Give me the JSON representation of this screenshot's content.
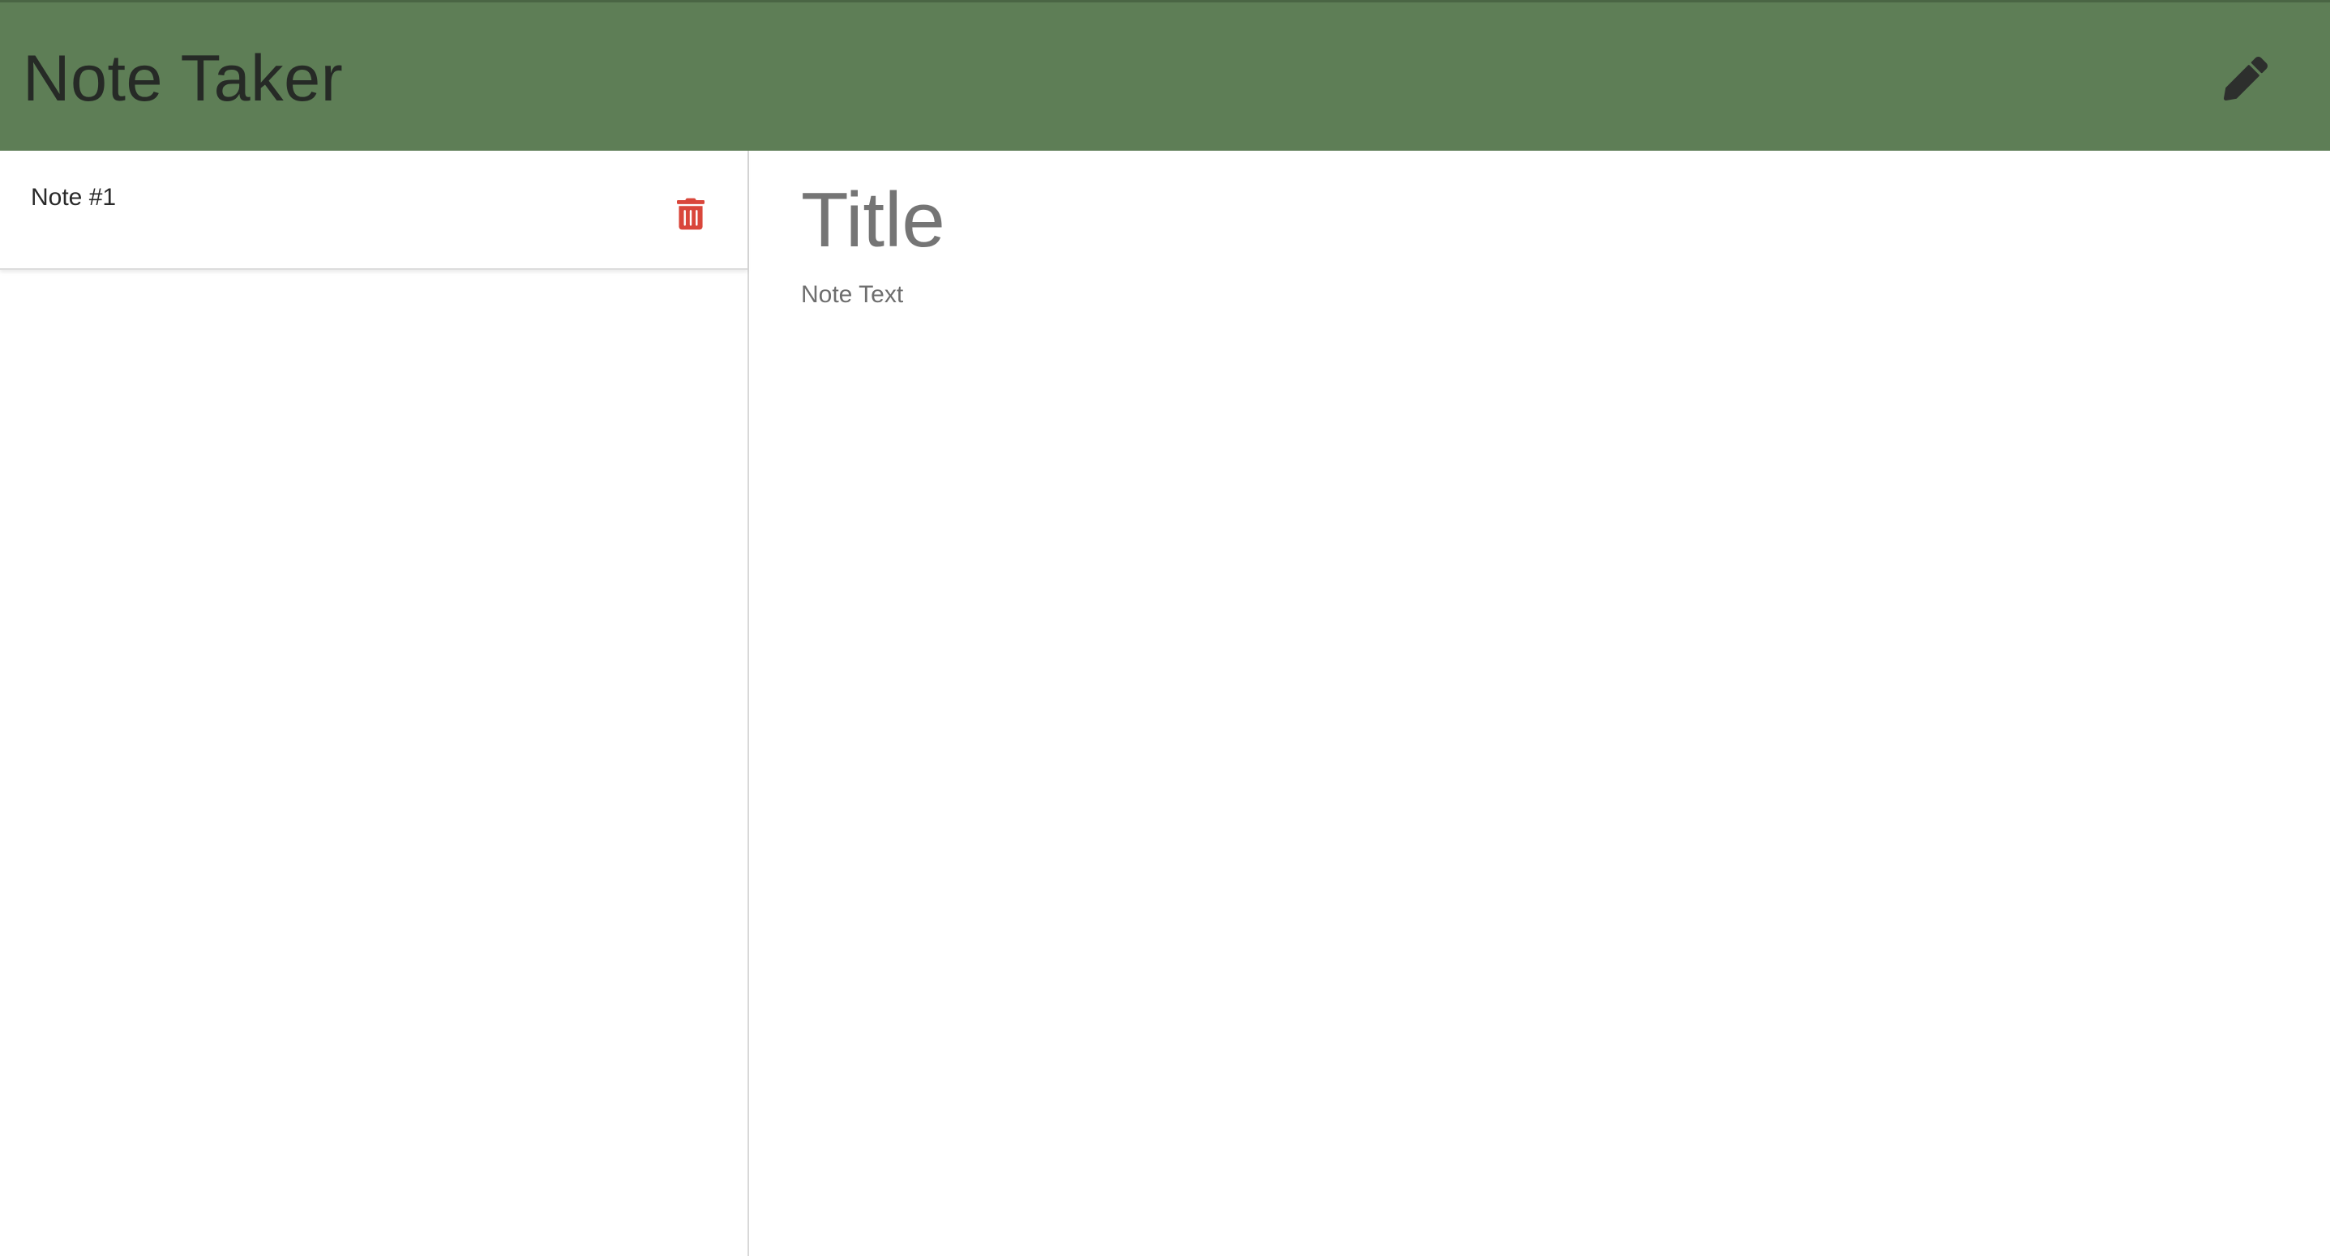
{
  "app": {
    "title": "Note Taker"
  },
  "toolbar": {
    "new_note_icon": "pencil-icon"
  },
  "notes": [
    {
      "title": "Note #1",
      "delete_icon": "trash-icon"
    }
  ],
  "editor": {
    "title_placeholder": "Title",
    "text_placeholder": "Note Text"
  },
  "colors": {
    "navbar": "#5e7e56",
    "title_text": "#262a26",
    "delete": "#d9463b",
    "placeholder": "#757575"
  }
}
